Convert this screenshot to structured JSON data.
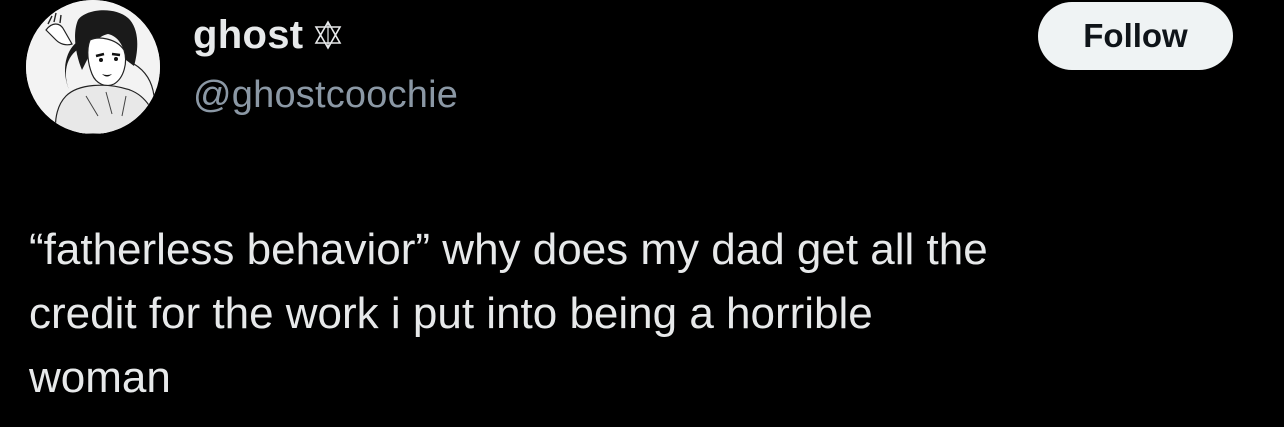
{
  "author": {
    "display_name": "ghost",
    "name_symbol_icon": "inverted-pentagram-icon",
    "handle": "@ghostcoochie",
    "avatar_icon": "manga-portrait-avatar"
  },
  "follow_button": {
    "label": "Follow"
  },
  "tweet": {
    "text": "“fatherless behavior” why does my dad get all the\ncredit for the work i put into being a horrible\nwoman"
  },
  "colors": {
    "background": "#000000",
    "primary_text": "#e7e9ea",
    "secondary_text": "#8b98a5",
    "button_bg": "#eff3f4",
    "button_text": "#0f1419"
  }
}
